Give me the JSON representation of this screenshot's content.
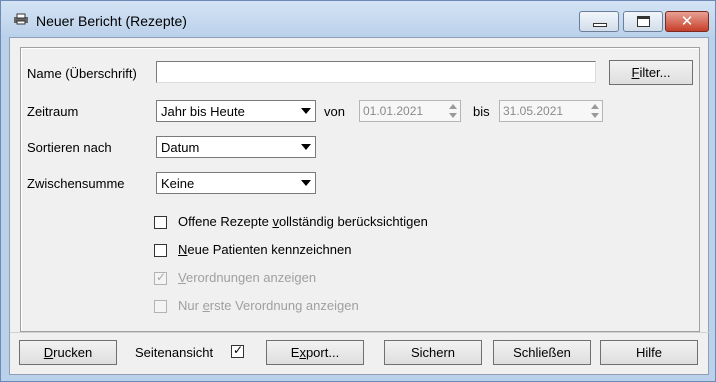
{
  "window": {
    "title": "Neuer Bericht (Rezepte)",
    "close_glyph": "✕"
  },
  "form": {
    "name_label": "Name (Überschrift)",
    "name_value": "",
    "filter_button": "Filter...",
    "zeitraum_label": "Zeitraum",
    "zeitraum_value": "Jahr bis Heute",
    "von_label": "von",
    "von_value": "01.01.2021",
    "bis_label": "bis",
    "bis_value": "31.05.2021",
    "sort_label": "Sortieren nach",
    "sort_value": "Datum",
    "subtotal_label": "Zwischensumme",
    "subtotal_value": "Keine"
  },
  "options": [
    {
      "pre": "Offene Rezepte ",
      "ul": "v",
      "post": "ollständig berücksichtigen",
      "checked": false,
      "enabled": true
    },
    {
      "pre": "",
      "ul": "N",
      "post": "eue Patienten kennzeichnen",
      "checked": false,
      "enabled": true
    },
    {
      "pre": "",
      "ul": "V",
      "post": "erordnungen anzeigen",
      "checked": true,
      "enabled": false
    },
    {
      "pre": "Nur ",
      "ul": "e",
      "post": "rste Verordnung anzeigen",
      "checked": false,
      "enabled": false
    }
  ],
  "footer": {
    "print_ul": "D",
    "print_rest": "rucken",
    "preview_label": "Seitenansicht",
    "preview_checked": true,
    "export_pre": "E",
    "export_ul": "x",
    "export_post": "port...",
    "save": "Sichern",
    "close": "Schließen",
    "help": "Hilfe"
  },
  "check_glyph": "✓"
}
